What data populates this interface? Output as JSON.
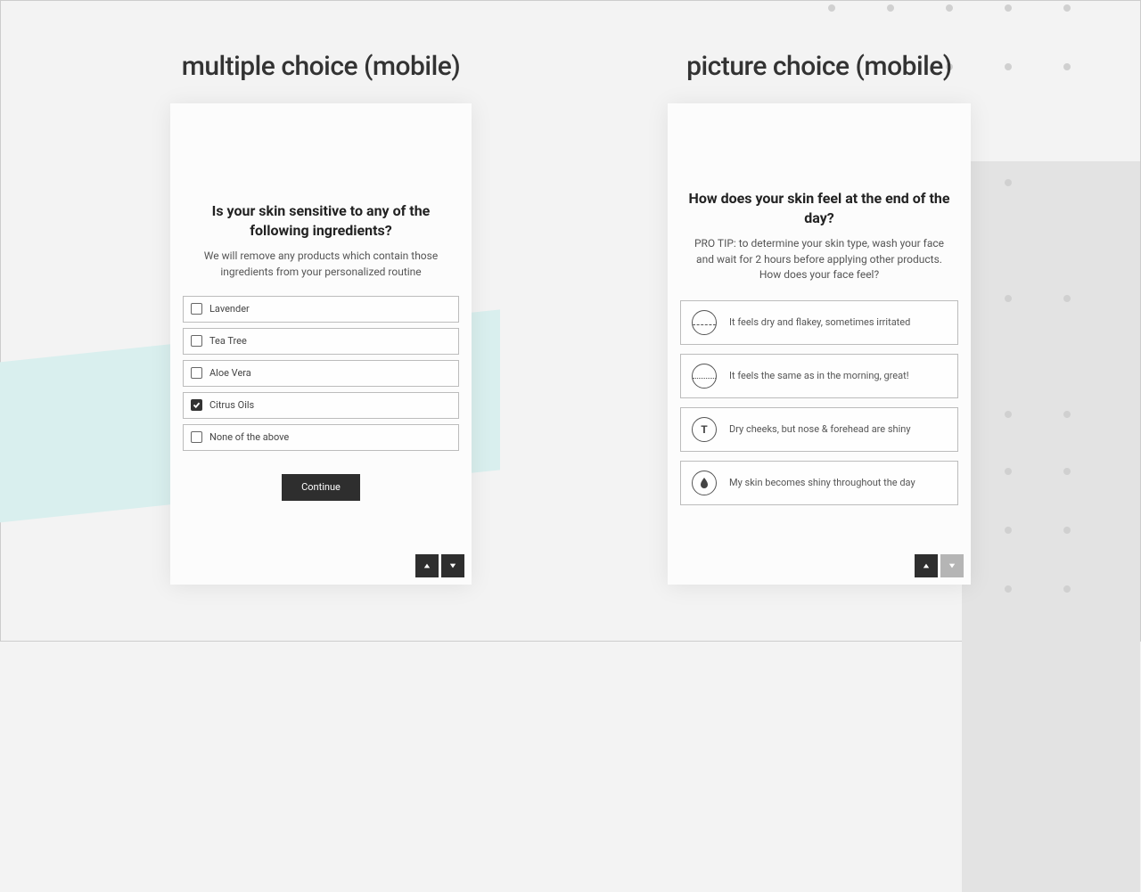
{
  "left": {
    "title": "multiple choice (mobile)",
    "question": "Is your skin sensitive to any of the following ingredients?",
    "description": "We will remove any products which contain those ingredients from your personalized routine",
    "options": {
      "o0": "Lavender",
      "o1": "Tea Tree",
      "o2": "Aloe Vera",
      "o3": "Citrus Oils",
      "o4": "None of the above"
    },
    "continue": "Continue"
  },
  "right": {
    "title": "picture choice (mobile)",
    "question": "How does your skin feel at the end of the day?",
    "description": "PRO TIP: to determine your skin type, wash your face and wait for 2 hours before applying other products. How does your face feel?",
    "options": {
      "p0": "It feels dry and flakey, sometimes irritated",
      "p1": "It feels the same as in the morning, great!",
      "p2": "Dry cheeks, but nose & forehead are shiny",
      "p3": "My skin becomes shiny throughout the day"
    },
    "icon2": "T"
  }
}
